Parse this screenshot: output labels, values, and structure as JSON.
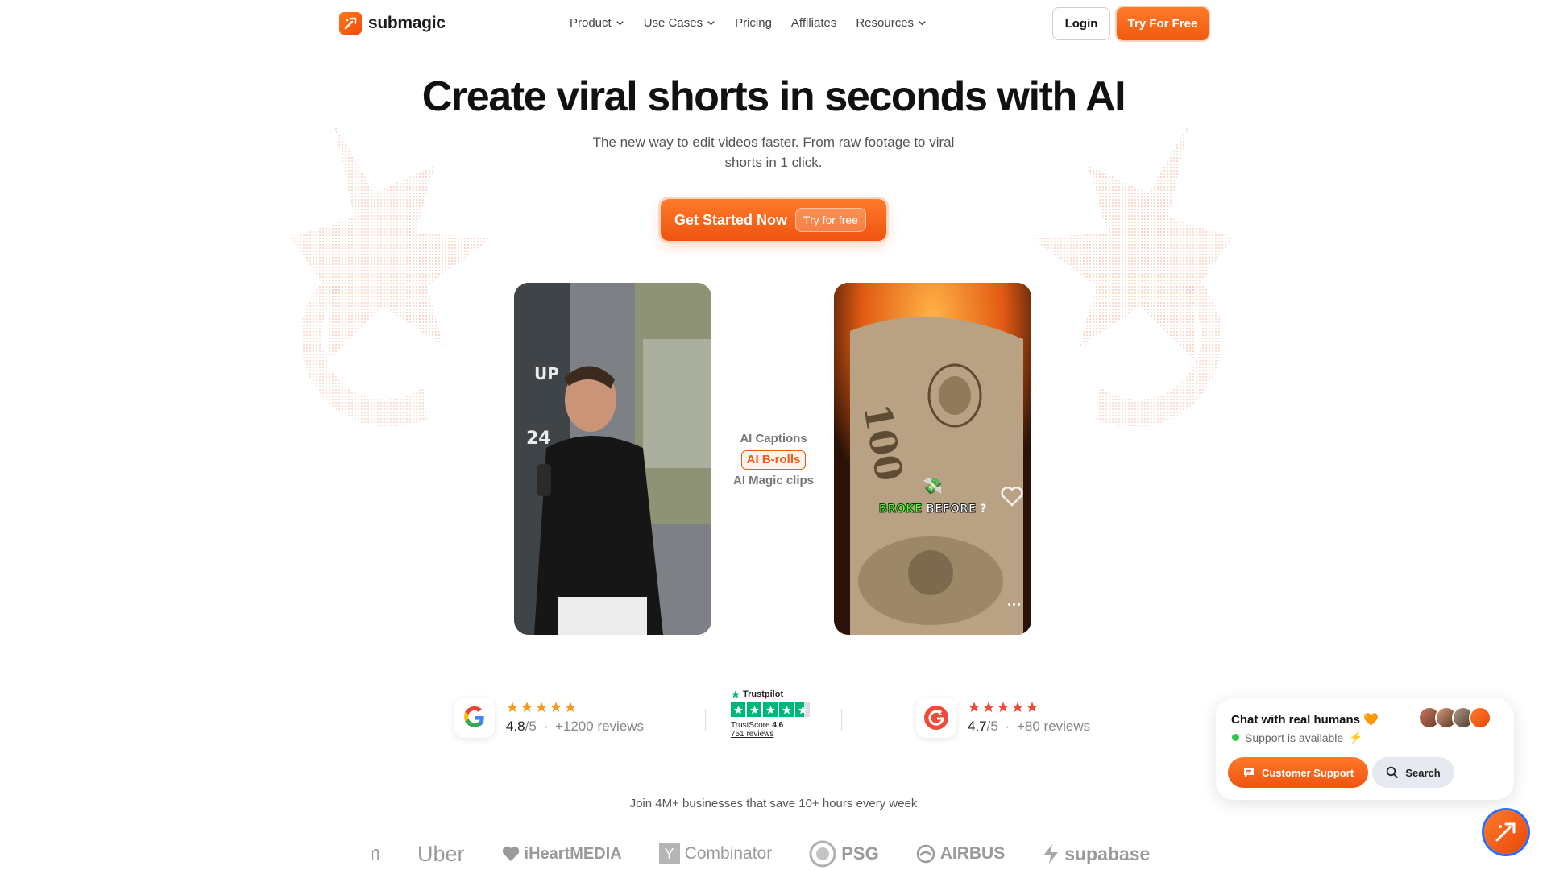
{
  "brand": {
    "name": "submagic"
  },
  "nav": {
    "items": [
      {
        "label": "Product",
        "has_dropdown": true
      },
      {
        "label": "Use Cases",
        "has_dropdown": true
      },
      {
        "label": "Pricing",
        "has_dropdown": false
      },
      {
        "label": "Affiliates",
        "has_dropdown": false
      },
      {
        "label": "Resources",
        "has_dropdown": true
      }
    ],
    "login_label": "Login",
    "try_label": "Try For Free"
  },
  "hero": {
    "title": "Create viral shorts in seconds with AI",
    "subtitle": "The new way to edit videos faster. From raw footage to viral shorts in 1 click.",
    "cta_label": "Get Started Now",
    "cta_pill": "Try for free"
  },
  "demo": {
    "features": [
      "AI Captions",
      "AI B-rolls",
      "AI Magic clips"
    ],
    "active_feature": "AI B-rolls",
    "caption_highlight": "BROKE",
    "caption_rest": "BEFORE",
    "caption_punct": "?",
    "caption_emoji": "💸"
  },
  "reviews": {
    "google": {
      "rating": 5,
      "score": "4.8",
      "out_of": "/5",
      "dot": "·",
      "count": "+1200 reviews"
    },
    "trustpilot": {
      "brand": "Trustpilot",
      "label": "TrustScore",
      "score": "4.6",
      "reviews_link": "751 reviews"
    },
    "g2": {
      "rating": 5,
      "score": "4.7",
      "out_of": "/5",
      "dot": "·",
      "count": "+80 reviews"
    }
  },
  "social_proof": {
    "text": "Join 4M+ businesses that save 10+ hours every week",
    "logos": [
      "m",
      "Uber",
      "iHeartMEDIA",
      "Combinator",
      "PSG",
      "AIRBUS",
      "supabase"
    ]
  },
  "chat": {
    "title": "Chat with real humans",
    "title_emoji": "🧡",
    "status": "Support is available",
    "status_emoji": "⚡",
    "support_label": "Customer Support",
    "search_label": "Search"
  },
  "colors": {
    "accent": "#f05a10",
    "star_orange": "#f59a1a",
    "star_red": "#ef4a3b",
    "trustpilot_green": "#00b67a"
  }
}
